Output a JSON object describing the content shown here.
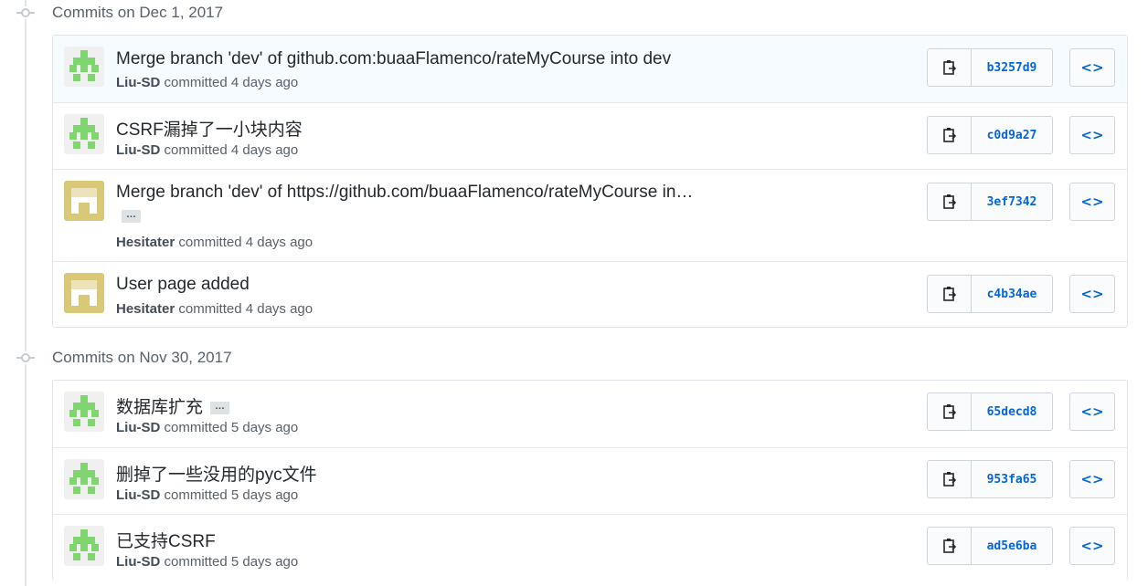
{
  "groups": [
    {
      "heading": "Commits on Dec 1, 2017",
      "commits": [
        {
          "message": "Merge branch 'dev' of github.com:buaaFlamenco/rateMyCourse into dev",
          "author": "Liu-SD",
          "when": "committed 4 days ago",
          "sha": "b3257d9",
          "avatar": "green"
        },
        {
          "message": "CSRF漏掉了一小块内容",
          "author": "Liu-SD",
          "when": "committed 4 days ago",
          "sha": "c0d9a27",
          "avatar": "green"
        },
        {
          "message": "Merge branch 'dev' of https://github.com/buaaFlamenco/rateMyCourse in…",
          "ellipsis": "…",
          "author": "Hesitater",
          "when": "committed 4 days ago",
          "sha": "3ef7342",
          "avatar": "yellow"
        },
        {
          "message": "User page added",
          "author": "Hesitater",
          "when": "committed 4 days ago",
          "sha": "c4b34ae",
          "avatar": "yellow"
        }
      ]
    },
    {
      "heading": "Commits on Nov 30, 2017",
      "commits": [
        {
          "message": "数据库扩充",
          "ellipsis": "…",
          "author": "Liu-SD",
          "when": "committed 5 days ago",
          "sha": "65decd8",
          "avatar": "green"
        },
        {
          "message": "删掉了一些没用的pyc文件",
          "author": "Liu-SD",
          "when": "committed 5 days ago",
          "sha": "953fa65",
          "avatar": "green"
        },
        {
          "message": "已支持CSRF",
          "author": "Liu-SD",
          "when": "committed 5 days ago",
          "sha": "ad5e6ba",
          "avatar": "green"
        }
      ]
    }
  ],
  "icons": {
    "copy": "clipboard-icon",
    "browse": "code-icon",
    "timeline": "commit-dot-icon"
  },
  "browse_glyph": "<>",
  "colors": {
    "link": "#0366d6",
    "green_avatar": "#7fd66e",
    "yellow_avatar": "#d9c877",
    "highlight_row": "#f6fbff"
  }
}
